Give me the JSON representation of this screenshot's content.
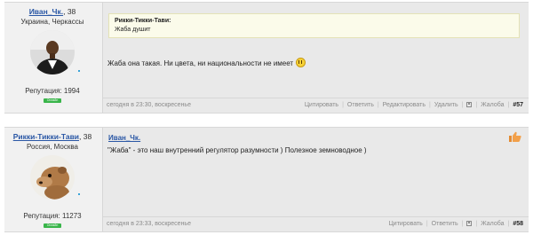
{
  "posts": [
    {
      "author": "Иван_Чк.",
      "age": "38",
      "location": "Украина, Черкассы",
      "avatar": "man-in-suit-photo",
      "reputation": "Репутация: 1994",
      "badge": "Онлайн",
      "quote": {
        "author": "Рикки-Тикки-Тави:",
        "text": "Жаба душит"
      },
      "message": "Жаба она такая. Ни цвета, ни национальности не имеет",
      "date": "сегодня в 23:30, воскресенье",
      "actions": [
        "Цитировать",
        "Ответить",
        "Редактировать",
        "Удалить",
        "Жалоба"
      ],
      "post_number": "#57"
    },
    {
      "author": "Рикки-Тикки-Тави",
      "age": "38",
      "location": "Россия, Москва",
      "avatar": "mongoose-photo",
      "reputation": "Репутация: 11273",
      "badge": "Онлайн",
      "reply_to": "Иван_Чк.",
      "message": "\"Жаба\" - это наш внутренний регулятор разумности ) Полезное земноводное )",
      "date": "сегодня в 23:33, воскресенье",
      "actions": [
        "Цитировать",
        "Ответить",
        "Жалоба"
      ],
      "post_number": "#58"
    }
  ],
  "icons": {
    "smiley": "smiley-icon",
    "thumb": "thumbs-up-icon",
    "save": "save-icon"
  },
  "colors": {
    "link": "#2a57a5",
    "online": "#39b54a",
    "quote_bg": "#fbfbea"
  }
}
